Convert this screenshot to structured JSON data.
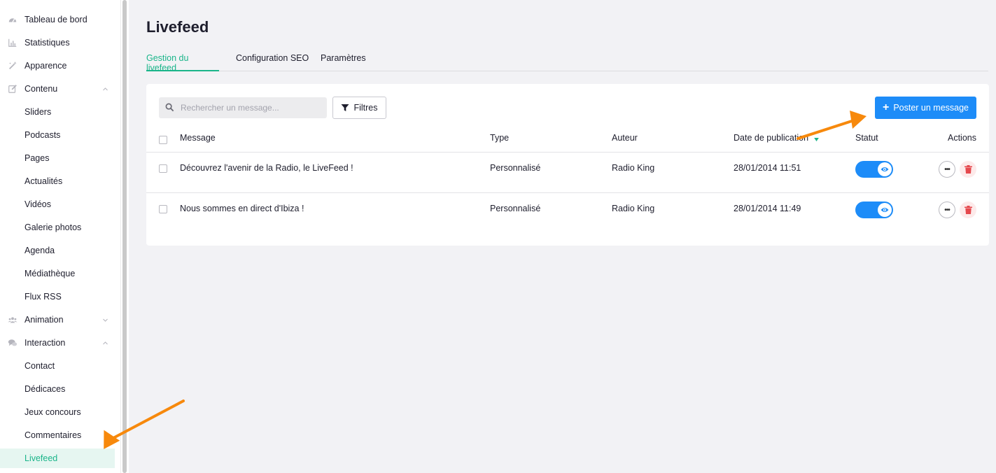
{
  "sidebar": {
    "items": [
      {
        "label": "Tableau de bord",
        "icon": "dashboard-icon"
      },
      {
        "label": "Statistiques",
        "icon": "bar-chart-icon"
      },
      {
        "label": "Apparence",
        "icon": "magic-wand-icon"
      },
      {
        "label": "Contenu",
        "icon": "edit-icon",
        "chevron": "up"
      },
      {
        "label": "Sliders"
      },
      {
        "label": "Podcasts"
      },
      {
        "label": "Pages"
      },
      {
        "label": "Actualités"
      },
      {
        "label": "Vidéos"
      },
      {
        "label": "Galerie photos"
      },
      {
        "label": "Agenda"
      },
      {
        "label": "Médiathèque"
      },
      {
        "label": "Flux RSS"
      },
      {
        "label": "Animation",
        "icon": "users-icon",
        "chevron": "down"
      },
      {
        "label": "Interaction",
        "icon": "chat-icon",
        "chevron": "up"
      },
      {
        "label": "Contact"
      },
      {
        "label": "Dédicaces"
      },
      {
        "label": "Jeux concours"
      },
      {
        "label": "Commentaires"
      },
      {
        "label": "Livefeed",
        "active": true
      }
    ]
  },
  "page": {
    "title": "Livefeed",
    "tabs": [
      {
        "label": "Gestion du livefeed",
        "active": true
      },
      {
        "label": "Configuration SEO"
      },
      {
        "label": "Paramètres"
      }
    ]
  },
  "toolbar": {
    "search_placeholder": "Rechercher un message...",
    "filters_label": "Filtres",
    "post_label": "Poster un message"
  },
  "table": {
    "columns": [
      "Message",
      "Type",
      "Auteur",
      "Date de publication",
      "Statut",
      "Actions"
    ],
    "rows": [
      {
        "message": "Découvrez l'avenir de la Radio, le LiveFeed !",
        "type": "Personnalisé",
        "author": "Radio King",
        "date": "28/01/2014 11:51",
        "status_visible": true
      },
      {
        "message": "Nous sommes en direct d'Ibiza !",
        "type": "Personnalisé",
        "author": "Radio King",
        "date": "28/01/2014 11:49",
        "status_visible": true
      }
    ]
  },
  "colors": {
    "accent_green": "#1bb58a",
    "primary_blue": "#1d8cf8",
    "annotation_orange": "#f7890c",
    "delete_red": "#e5484d"
  }
}
